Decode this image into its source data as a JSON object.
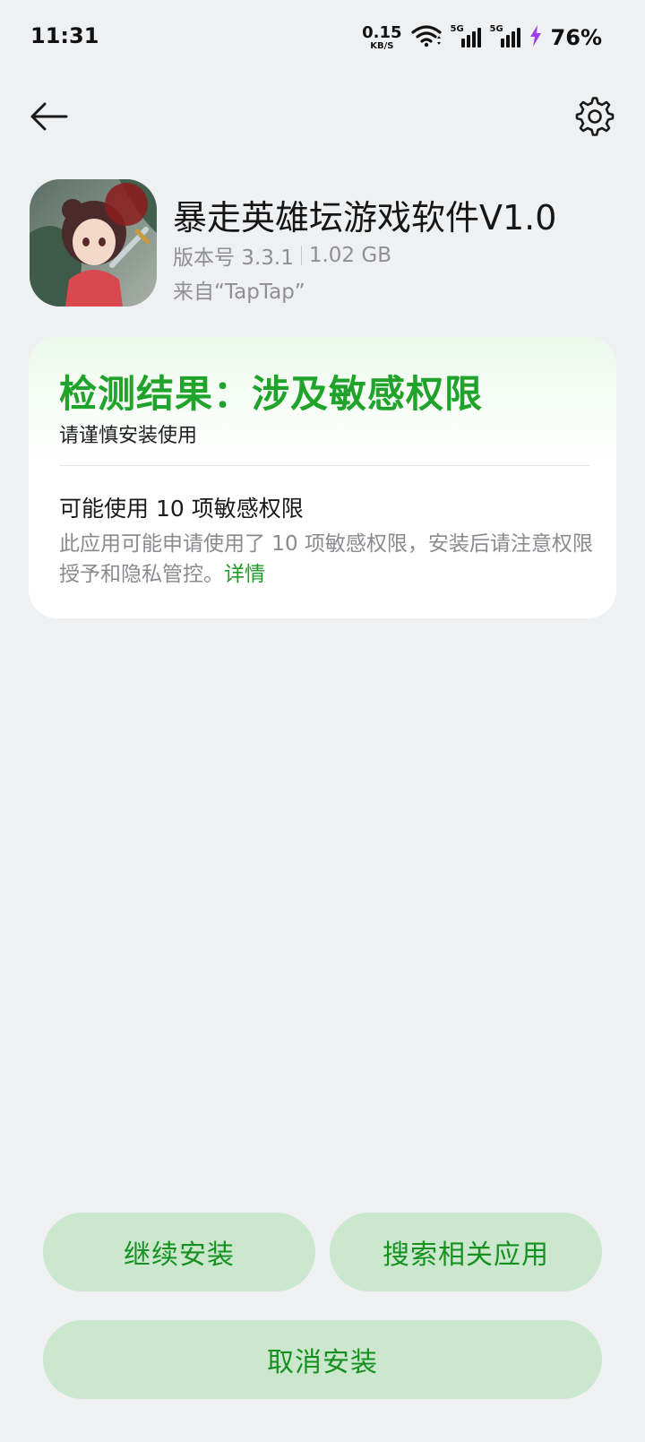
{
  "status_bar": {
    "time": "11:31",
    "net_speed_value": "0.15",
    "net_speed_unit": "KB/S",
    "signal1_tag": "5G",
    "signal2_tag": "5G",
    "battery": "76%",
    "charging_color": "#a23cf0"
  },
  "header": {
    "back_icon": "arrow-left-icon",
    "settings_icon": "gear-icon"
  },
  "app": {
    "name": "暴走英雄坛游戏软件V1.0",
    "version": "版本号 3.3.1",
    "size": "1.02 GB",
    "source": "来自“TapTap”",
    "icon_badge": "8周年"
  },
  "result": {
    "title": "检测结果：涉及敏感权限",
    "subtitle": "请谨慎安装使用",
    "item_title": "可能使用 10 项敏感权限",
    "item_desc": "此应用可能申请使用了 10 项敏感权限，安装后请注意权限授予和隐私管控。",
    "detail_link": "详情",
    "accent_color": "#20a32a"
  },
  "buttons": {
    "continue": "继续安装",
    "search": "搜索相关应用",
    "cancel": "取消安装",
    "bg_color": "#cbe8cf",
    "text_color": "#16901f"
  }
}
